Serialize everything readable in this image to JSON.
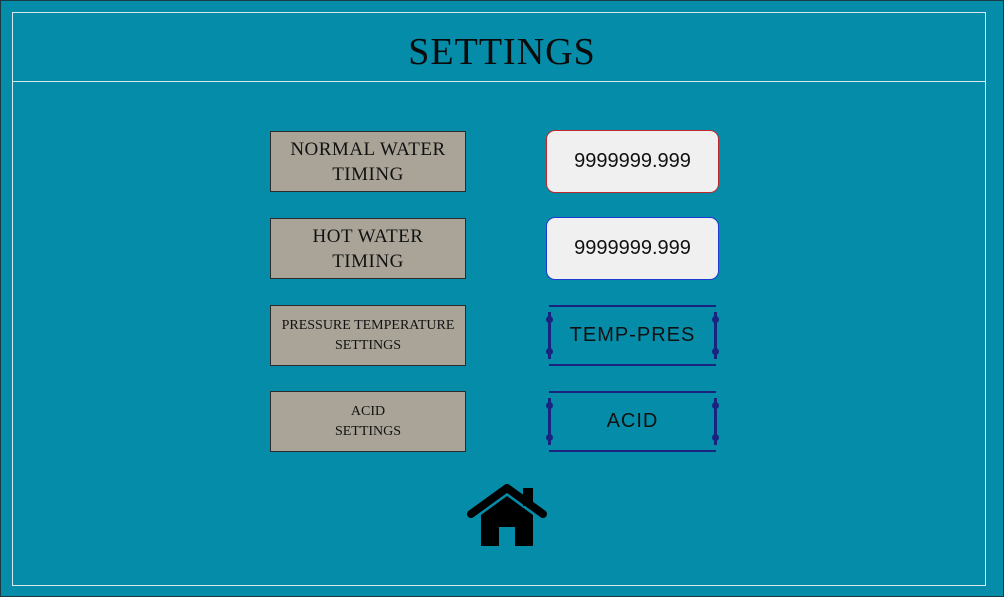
{
  "page": {
    "title": "SETTINGS"
  },
  "rows": [
    {
      "label": "NORMAL WATER\nTIMING",
      "value": "9999999.999"
    },
    {
      "label": "HOT WATER\nTIMING",
      "value": "9999999.999"
    },
    {
      "label": "PRESSURE TEMPERATURE\nSETTINGS",
      "button": "TEMP-PRES"
    },
    {
      "label": "ACID\nSETTINGS",
      "button": "ACID"
    }
  ],
  "nav": {
    "home_icon": "home-icon"
  },
  "colors": {
    "background": "#058ca8",
    "label_box": "#a9a497",
    "button_border": "#1a237e"
  }
}
